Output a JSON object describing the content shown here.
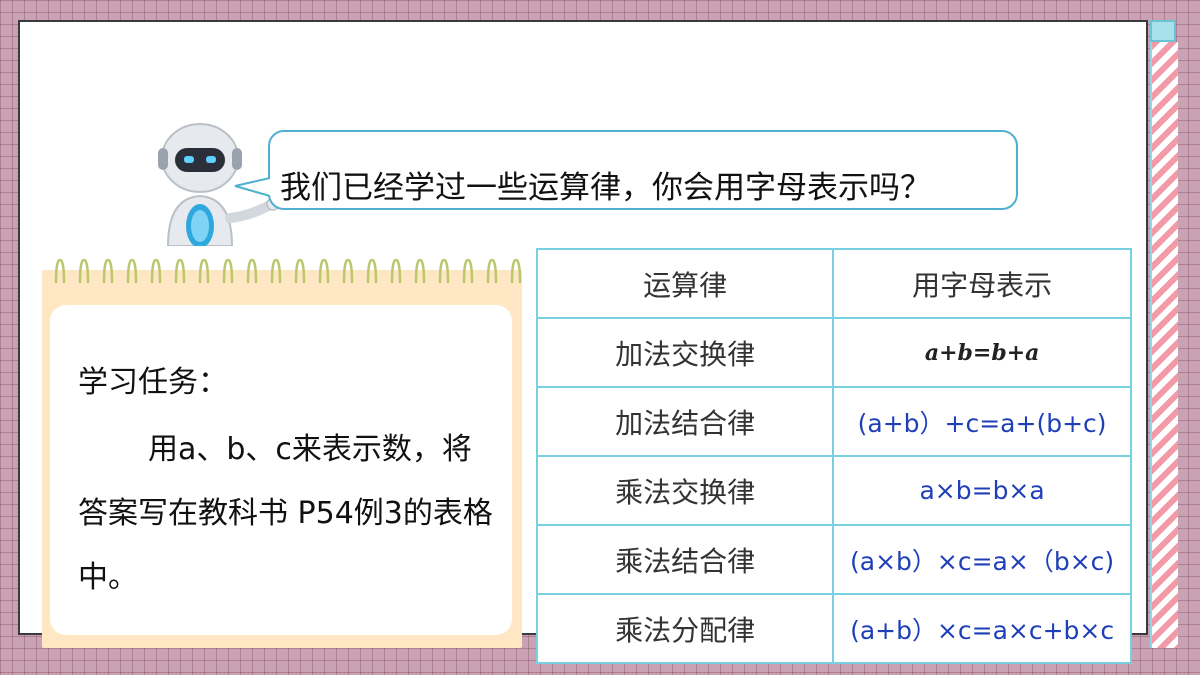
{
  "robot_icon": "robot-icon",
  "speech": {
    "text": "我们已经学过一些运算律，你会用字母表示吗？"
  },
  "task": {
    "title": "学习任务：",
    "body": "用a、b、c来表示数，将答案写在教科书 P54例3的表格中。"
  },
  "table": {
    "headers": [
      "运算律",
      "用字母表示"
    ],
    "rows": [
      {
        "name": "加法交换律",
        "formula": "a+b=b+a"
      },
      {
        "name": "加法结合律",
        "formula": "(a+b）+c=a+(b+c)"
      },
      {
        "name": "乘法交换律",
        "formula": "a×b=b×a"
      },
      {
        "name": "乘法结合律",
        "formula": "(a×b）×c=a×（b×c)"
      },
      {
        "name": "乘法分配律",
        "formula": "(a+b）×c=a×c+b×c"
      }
    ]
  },
  "colors": {
    "background": "#c9a3b3",
    "accent_blue": "#4fb1cf",
    "table_border": "#78cfe0",
    "answer_text": "#1f3fb8",
    "notepad": "#ffe7c4",
    "stripe_pink": "#f29aa8"
  }
}
